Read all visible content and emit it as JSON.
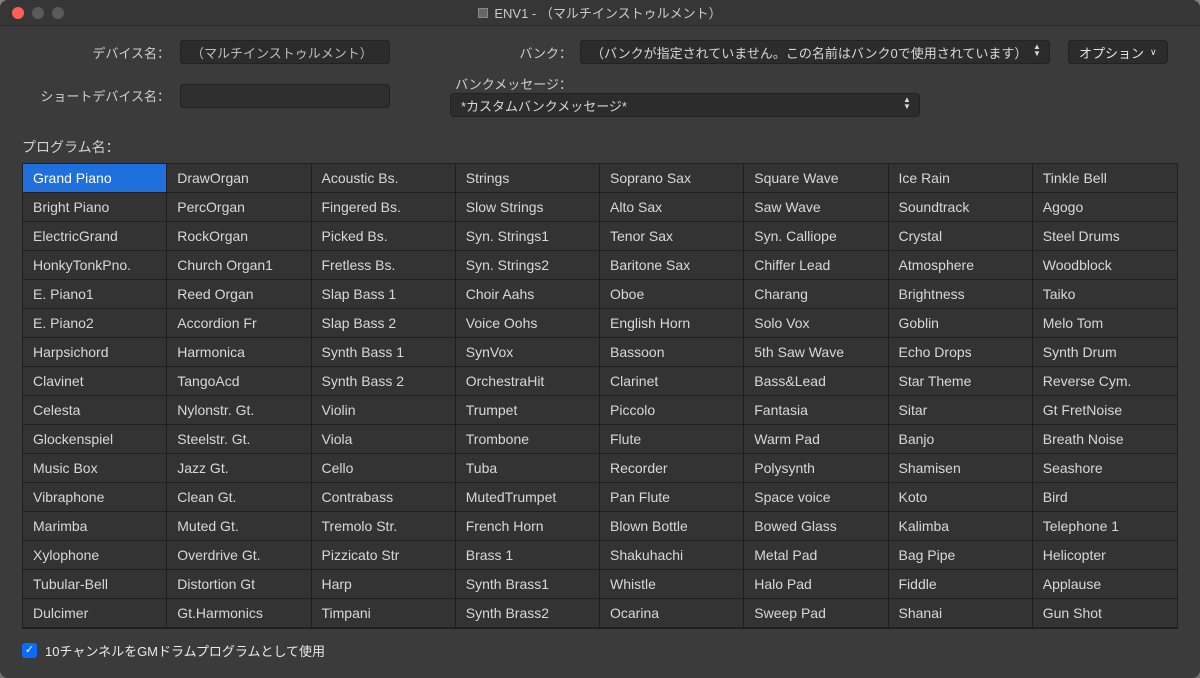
{
  "window": {
    "title": "ENV1 - （マルチインストゥルメント）"
  },
  "form": {
    "device_name_label": "デバイス名：",
    "device_name_value": "（マルチインストゥルメント）",
    "short_name_label": "ショートデバイス名：",
    "short_name_value": "",
    "bank_label": "バンク：",
    "bank_value": "（バンクが指定されていません。この名前はバンク0で使用されています）",
    "bank_msg_label": "バンクメッセージ：",
    "bank_msg_value": "*カスタムバンクメッセージ*",
    "option_button": "オプション"
  },
  "programs_label": "プログラム名：",
  "selected_index": 0,
  "programs": [
    "Grand Piano",
    "DrawOrgan",
    "Acoustic Bs.",
    "Strings",
    "Soprano Sax",
    "Square Wave",
    "Ice Rain",
    "Tinkle Bell",
    "Bright Piano",
    "PercOrgan",
    "Fingered Bs.",
    "Slow Strings",
    "Alto Sax",
    "Saw Wave",
    "Soundtrack",
    "Agogo",
    "ElectricGrand",
    "RockOrgan",
    "Picked Bs.",
    "Syn. Strings1",
    "Tenor Sax",
    "Syn. Calliope",
    "Crystal",
    "Steel Drums",
    "HonkyTonkPno.",
    "Church Organ1",
    "Fretless Bs.",
    "Syn. Strings2",
    "Baritone Sax",
    "Chiffer Lead",
    "Atmosphere",
    "Woodblock",
    "E. Piano1",
    "Reed Organ",
    "Slap Bass 1",
    "Choir Aahs",
    "Oboe",
    "Charang",
    "Brightness",
    "Taiko",
    "E. Piano2",
    "Accordion Fr",
    "Slap Bass 2",
    "Voice Oohs",
    "English Horn",
    "Solo Vox",
    "Goblin",
    "Melo Tom",
    "Harpsichord",
    "Harmonica",
    "Synth Bass 1",
    "SynVox",
    "Bassoon",
    "5th Saw Wave",
    "Echo Drops",
    "Synth Drum",
    "Clavinet",
    "TangoAcd",
    "Synth Bass 2",
    "OrchestraHit",
    "Clarinet",
    "Bass&Lead",
    "Star Theme",
    "Reverse Cym.",
    "Celesta",
    "Nylonstr. Gt.",
    "Violin",
    "Trumpet",
    "Piccolo",
    "Fantasia",
    "Sitar",
    "Gt FretNoise",
    "Glockenspiel",
    "Steelstr. Gt.",
    "Viola",
    "Trombone",
    "Flute",
    "Warm Pad",
    "Banjo",
    "Breath Noise",
    "Music Box",
    "Jazz Gt.",
    "Cello",
    "Tuba",
    "Recorder",
    "Polysynth",
    "Shamisen",
    "Seashore",
    "Vibraphone",
    "Clean Gt.",
    "Contrabass",
    "MutedTrumpet",
    "Pan Flute",
    "Space voice",
    "Koto",
    "Bird",
    "Marimba",
    "Muted Gt.",
    "Tremolo Str.",
    "French Horn",
    "Blown Bottle",
    "Bowed Glass",
    "Kalimba",
    "Telephone 1",
    "Xylophone",
    "Overdrive Gt.",
    "Pizzicato Str",
    "Brass 1",
    "Shakuhachi",
    "Metal Pad",
    "Bag Pipe",
    "Helicopter",
    "Tubular-Bell",
    "Distortion Gt",
    "Harp",
    "Synth Brass1",
    "Whistle",
    "Halo Pad",
    "Fiddle",
    "Applause",
    "Dulcimer",
    "Gt.Harmonics",
    "Timpani",
    "Synth Brass2",
    "Ocarina",
    "Sweep Pad",
    "Shanai",
    "Gun Shot"
  ],
  "footer": {
    "checkbox_label": "10チャンネルをGMドラムプログラムとして使用",
    "checked": true
  }
}
